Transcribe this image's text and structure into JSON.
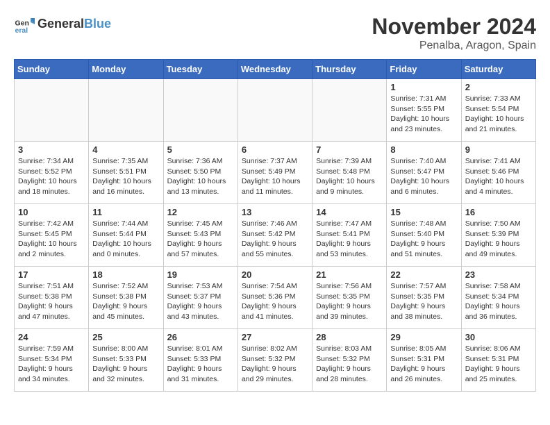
{
  "header": {
    "logo_line1": "General",
    "logo_line2": "Blue",
    "month": "November 2024",
    "location": "Penalba, Aragon, Spain"
  },
  "weekdays": [
    "Sunday",
    "Monday",
    "Tuesday",
    "Wednesday",
    "Thursday",
    "Friday",
    "Saturday"
  ],
  "weeks": [
    [
      {
        "day": "",
        "info": ""
      },
      {
        "day": "",
        "info": ""
      },
      {
        "day": "",
        "info": ""
      },
      {
        "day": "",
        "info": ""
      },
      {
        "day": "",
        "info": ""
      },
      {
        "day": "1",
        "info": "Sunrise: 7:31 AM\nSunset: 5:55 PM\nDaylight: 10 hours\nand 23 minutes."
      },
      {
        "day": "2",
        "info": "Sunrise: 7:33 AM\nSunset: 5:54 PM\nDaylight: 10 hours\nand 21 minutes."
      }
    ],
    [
      {
        "day": "3",
        "info": "Sunrise: 7:34 AM\nSunset: 5:52 PM\nDaylight: 10 hours\nand 18 minutes."
      },
      {
        "day": "4",
        "info": "Sunrise: 7:35 AM\nSunset: 5:51 PM\nDaylight: 10 hours\nand 16 minutes."
      },
      {
        "day": "5",
        "info": "Sunrise: 7:36 AM\nSunset: 5:50 PM\nDaylight: 10 hours\nand 13 minutes."
      },
      {
        "day": "6",
        "info": "Sunrise: 7:37 AM\nSunset: 5:49 PM\nDaylight: 10 hours\nand 11 minutes."
      },
      {
        "day": "7",
        "info": "Sunrise: 7:39 AM\nSunset: 5:48 PM\nDaylight: 10 hours\nand 9 minutes."
      },
      {
        "day": "8",
        "info": "Sunrise: 7:40 AM\nSunset: 5:47 PM\nDaylight: 10 hours\nand 6 minutes."
      },
      {
        "day": "9",
        "info": "Sunrise: 7:41 AM\nSunset: 5:46 PM\nDaylight: 10 hours\nand 4 minutes."
      }
    ],
    [
      {
        "day": "10",
        "info": "Sunrise: 7:42 AM\nSunset: 5:45 PM\nDaylight: 10 hours\nand 2 minutes."
      },
      {
        "day": "11",
        "info": "Sunrise: 7:44 AM\nSunset: 5:44 PM\nDaylight: 10 hours\nand 0 minutes."
      },
      {
        "day": "12",
        "info": "Sunrise: 7:45 AM\nSunset: 5:43 PM\nDaylight: 9 hours\nand 57 minutes."
      },
      {
        "day": "13",
        "info": "Sunrise: 7:46 AM\nSunset: 5:42 PM\nDaylight: 9 hours\nand 55 minutes."
      },
      {
        "day": "14",
        "info": "Sunrise: 7:47 AM\nSunset: 5:41 PM\nDaylight: 9 hours\nand 53 minutes."
      },
      {
        "day": "15",
        "info": "Sunrise: 7:48 AM\nSunset: 5:40 PM\nDaylight: 9 hours\nand 51 minutes."
      },
      {
        "day": "16",
        "info": "Sunrise: 7:50 AM\nSunset: 5:39 PM\nDaylight: 9 hours\nand 49 minutes."
      }
    ],
    [
      {
        "day": "17",
        "info": "Sunrise: 7:51 AM\nSunset: 5:38 PM\nDaylight: 9 hours\nand 47 minutes."
      },
      {
        "day": "18",
        "info": "Sunrise: 7:52 AM\nSunset: 5:38 PM\nDaylight: 9 hours\nand 45 minutes."
      },
      {
        "day": "19",
        "info": "Sunrise: 7:53 AM\nSunset: 5:37 PM\nDaylight: 9 hours\nand 43 minutes."
      },
      {
        "day": "20",
        "info": "Sunrise: 7:54 AM\nSunset: 5:36 PM\nDaylight: 9 hours\nand 41 minutes."
      },
      {
        "day": "21",
        "info": "Sunrise: 7:56 AM\nSunset: 5:35 PM\nDaylight: 9 hours\nand 39 minutes."
      },
      {
        "day": "22",
        "info": "Sunrise: 7:57 AM\nSunset: 5:35 PM\nDaylight: 9 hours\nand 38 minutes."
      },
      {
        "day": "23",
        "info": "Sunrise: 7:58 AM\nSunset: 5:34 PM\nDaylight: 9 hours\nand 36 minutes."
      }
    ],
    [
      {
        "day": "24",
        "info": "Sunrise: 7:59 AM\nSunset: 5:34 PM\nDaylight: 9 hours\nand 34 minutes."
      },
      {
        "day": "25",
        "info": "Sunrise: 8:00 AM\nSunset: 5:33 PM\nDaylight: 9 hours\nand 32 minutes."
      },
      {
        "day": "26",
        "info": "Sunrise: 8:01 AM\nSunset: 5:33 PM\nDaylight: 9 hours\nand 31 minutes."
      },
      {
        "day": "27",
        "info": "Sunrise: 8:02 AM\nSunset: 5:32 PM\nDaylight: 9 hours\nand 29 minutes."
      },
      {
        "day": "28",
        "info": "Sunrise: 8:03 AM\nSunset: 5:32 PM\nDaylight: 9 hours\nand 28 minutes."
      },
      {
        "day": "29",
        "info": "Sunrise: 8:05 AM\nSunset: 5:31 PM\nDaylight: 9 hours\nand 26 minutes."
      },
      {
        "day": "30",
        "info": "Sunrise: 8:06 AM\nSunset: 5:31 PM\nDaylight: 9 hours\nand 25 minutes."
      }
    ]
  ]
}
